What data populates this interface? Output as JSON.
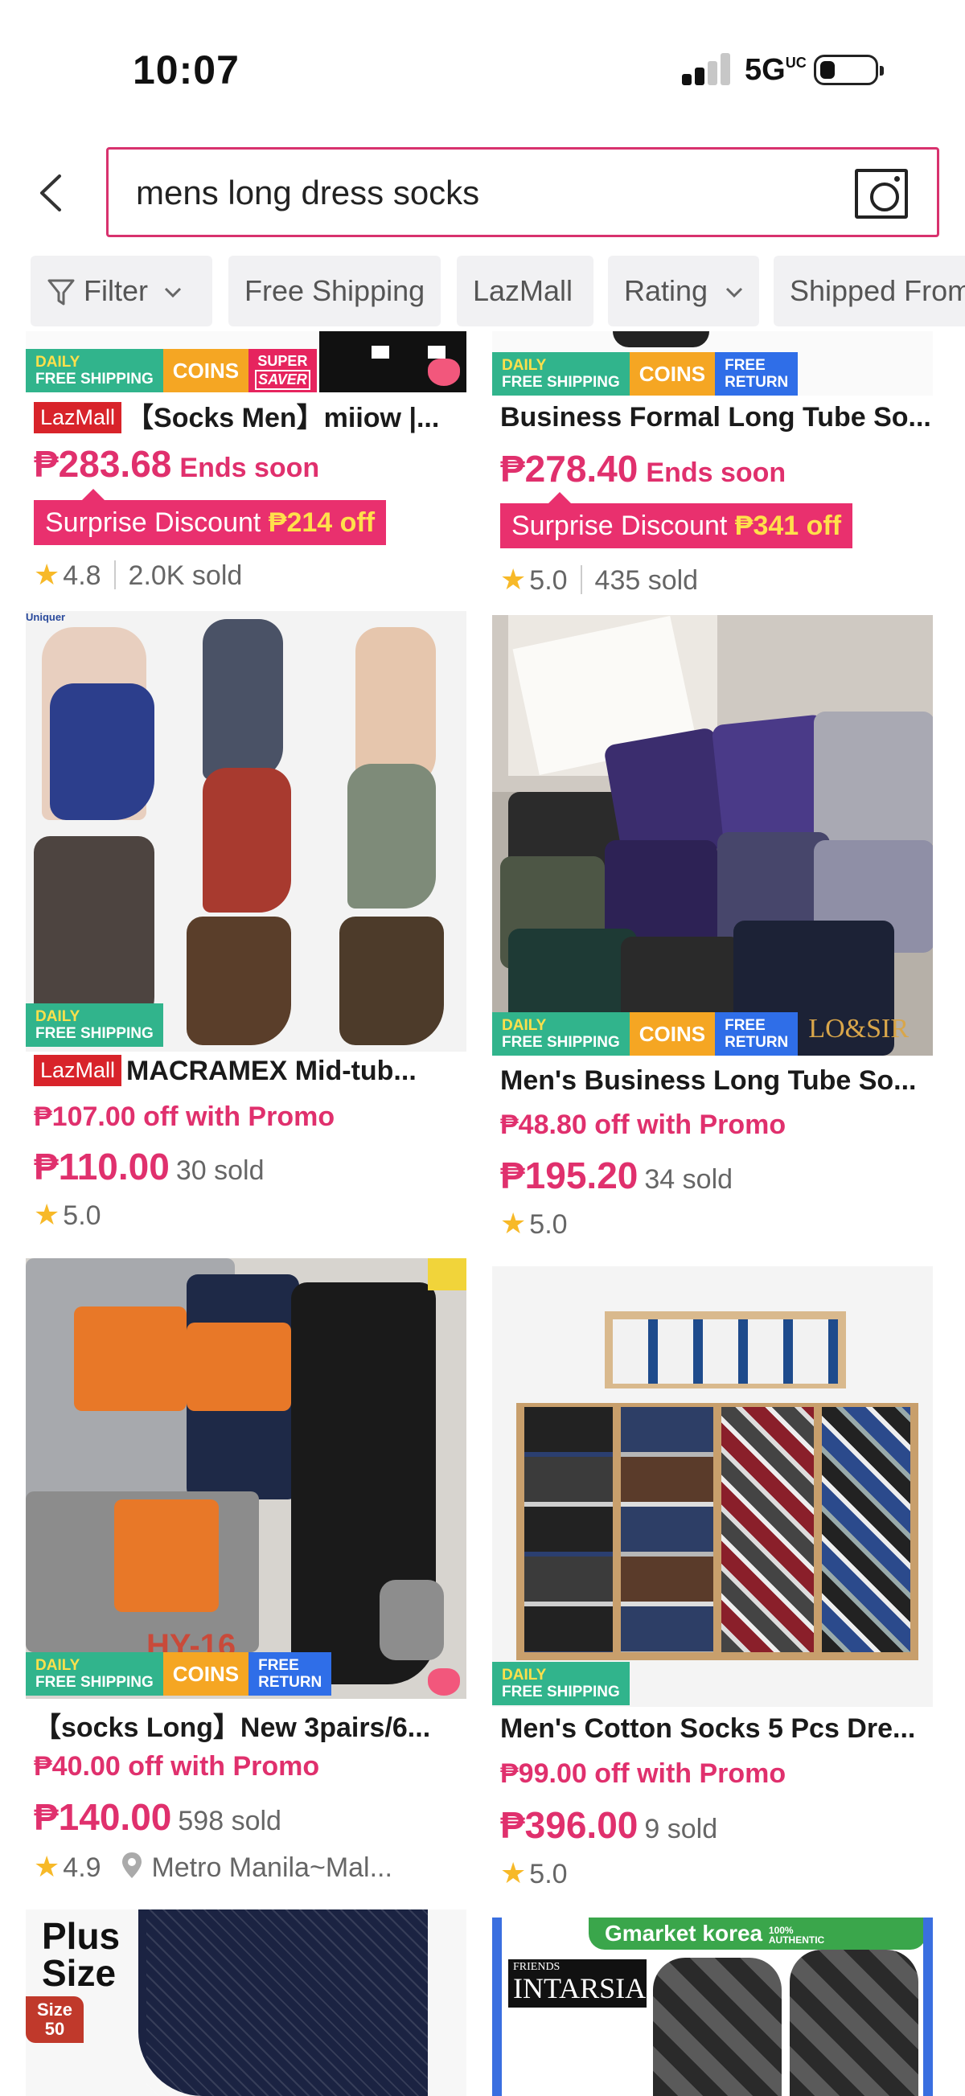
{
  "status_bar": {
    "time": "10:07",
    "network": "5G",
    "network_suffix": "UC"
  },
  "search": {
    "query": "mens long dress socks"
  },
  "filters": [
    {
      "label": "Filter",
      "has_dropdown": true,
      "icon": "funnel-icon"
    },
    {
      "label": "Free Shipping",
      "has_dropdown": false
    },
    {
      "label": "LazMall",
      "has_dropdown": false
    },
    {
      "label": "Rating",
      "has_dropdown": true
    },
    {
      "label": "Shipped From",
      "has_dropdown": false
    }
  ],
  "badges": {
    "daily": "DAILY",
    "free_shipping": "FREE SHIPPING",
    "coins": "COINS",
    "free": "FREE",
    "return": "RETURN",
    "super": "SUPER",
    "saver": "SAVER",
    "lazmall": "LazMall"
  },
  "products": [
    {
      "title": "【Socks Men】miiow |...",
      "lazmall": true,
      "price": "₱283.68",
      "price_note": "Ends soon",
      "surprise": {
        "label": "Surprise Discount",
        "amount": "₱214 off"
      },
      "rating": "4.8",
      "sold": "2.0K sold"
    },
    {
      "title": "Business Formal Long Tube So...",
      "lazmall": false,
      "price": "₱278.40",
      "price_note": "Ends soon",
      "surprise": {
        "label": "Surprise Discount",
        "amount": "₱341 off"
      },
      "rating": "5.0",
      "sold": "435 sold"
    },
    {
      "title": "MACRAMEX Mid-tub...",
      "lazmall": true,
      "image_caption": "Uniquer",
      "promo": "₱107.00 off with Promo",
      "price": "₱110.00",
      "sold": "30 sold",
      "rating": "5.0"
    },
    {
      "title": "Men's Business Long Tube So...",
      "lazmall": false,
      "image_caption": "LO&SIR",
      "promo": "₱48.80 off with Promo",
      "price": "₱195.20",
      "sold": "34 sold",
      "rating": "5.0"
    },
    {
      "title": "【socks Long】New 3pairs/6...",
      "lazmall": false,
      "image_caption": "HY-16",
      "promo": "₱40.00 off with Promo",
      "price": "₱140.00",
      "sold": "598 sold",
      "rating": "4.9",
      "location": "Metro Manila~Mal..."
    },
    {
      "title": "Men's Cotton Socks 5 Pcs Dre...",
      "lazmall": false,
      "promo": "₱99.00 off with Promo",
      "price": "₱396.00",
      "sold": "9 sold",
      "rating": "5.0"
    },
    {
      "image_caption": "Plus Size",
      "image_badge": "Size 50"
    },
    {
      "image_brand": "Gmarket korea",
      "image_brand_tag": "100% AUTHENTIC",
      "image_caption_top": "FRIENDS",
      "image_caption": "INTARSIA"
    }
  ],
  "colors": {
    "accent": "#e0306d",
    "free_shipping_badge": "#31b48c",
    "coins_badge": "#f5a623",
    "return_badge": "#2f6ee8",
    "lazmall_red": "#d8232a",
    "star": "#f7b928"
  }
}
